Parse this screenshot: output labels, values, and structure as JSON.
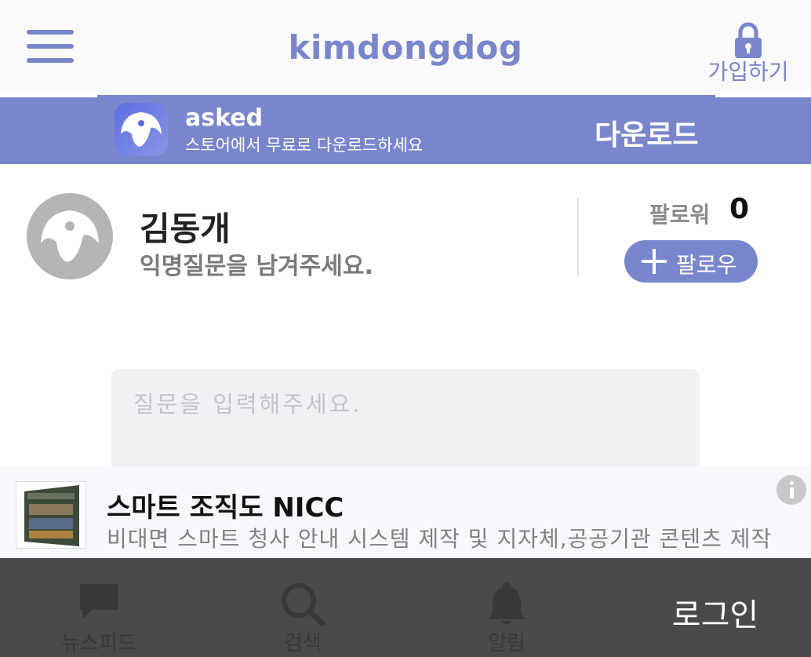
{
  "header": {
    "title": "kimdongdog",
    "menu_icon": "hamburger-menu-icon",
    "signup_icon": "lock-icon",
    "signup_label": "가입하기",
    "accent_color": "#7a86cc"
  },
  "app_banner": {
    "app_name": "asked",
    "subtitle": "스토어에서 무료로 다운로드하세요",
    "download_label": "다운로드",
    "background_color": "#7a86cc"
  },
  "profile": {
    "name": "김동개",
    "description": "익명질문을 남겨주세요.",
    "follower_label": "팔로워",
    "follower_count": "0",
    "follow_button_label": "팔로우"
  },
  "question": {
    "placeholder": "질문을 입력해주세요."
  },
  "ad": {
    "title": "스마트 조직도 NICC",
    "description": "비대면 스마트 청사 안내 시스템 제작 및 지자체,공공기관 콘텐츠 제작",
    "info_icon": "info-icon"
  },
  "bottom_nav": {
    "items": [
      {
        "label": "뉴스피드",
        "icon": "chat-bubble-icon"
      },
      {
        "label": "검색",
        "icon": "search-icon"
      },
      {
        "label": "알림",
        "icon": "bell-icon"
      }
    ],
    "login_label": "로그인",
    "background_color": "#4a4a4a"
  }
}
